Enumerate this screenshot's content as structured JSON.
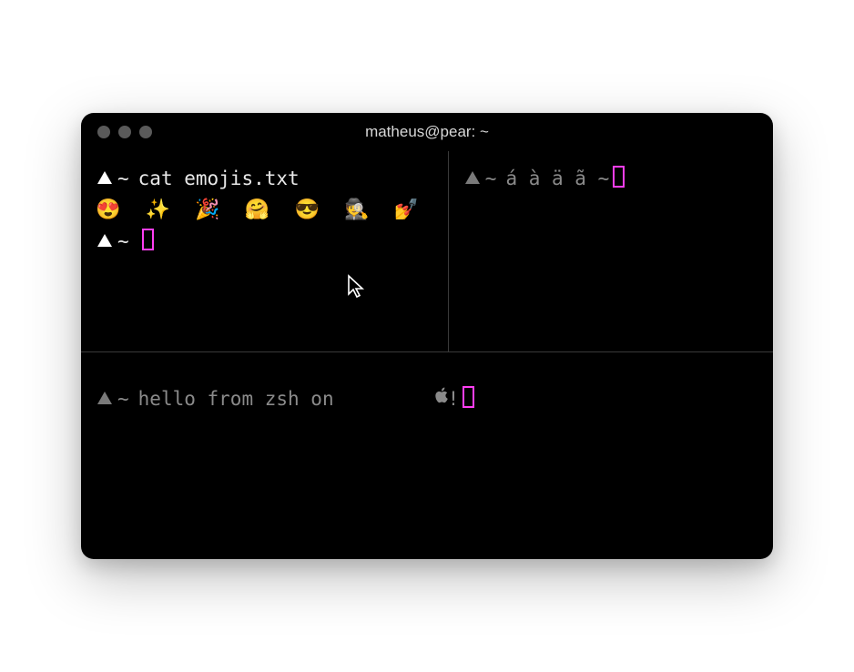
{
  "window": {
    "title": "matheus@pear: ~"
  },
  "panes": {
    "topLeft": {
      "promptSymbol": "~",
      "line1_command": "cat emojis.txt",
      "line2_output": "😍 ✨ 🎉 🤗 😎 🕵️ 💅",
      "line3_prompt": "~"
    },
    "topRight": {
      "promptSymbol": "~",
      "text": "á à ä ã ~"
    },
    "bottom": {
      "promptSymbol": "~",
      "text": "hello from zsh on ",
      "suffix": "!"
    }
  },
  "colors": {
    "cursor": "#ff3ef2",
    "background": "#000000",
    "foreground": "#e8e8e8",
    "dim": "#8a8a8a"
  }
}
